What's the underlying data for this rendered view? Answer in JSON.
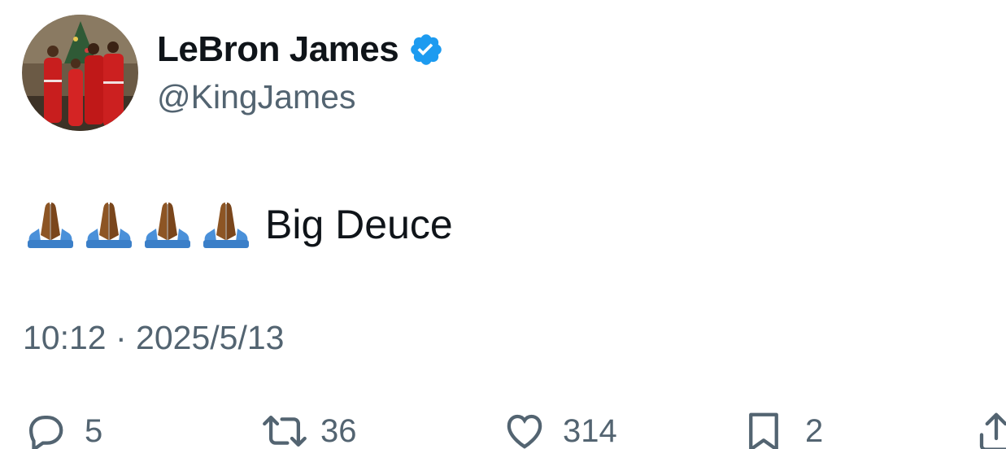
{
  "author": {
    "display_name": "LeBron James",
    "handle": "@KingJames",
    "verified": true,
    "avatar_icon": "family-photo-avatar"
  },
  "tweet": {
    "emoji": [
      "🙏🏾",
      "🙏🏾",
      "🙏🏾",
      "🙏🏾"
    ],
    "text": "Big Deuce",
    "timestamp": "10:12 · 2025/5/13"
  },
  "actions": {
    "replies": {
      "icon": "reply-icon",
      "count": "5"
    },
    "reposts": {
      "icon": "repost-icon",
      "count": "36"
    },
    "likes": {
      "icon": "like-icon",
      "count": "314"
    },
    "bookmarks": {
      "icon": "bookmark-icon",
      "count": "2"
    },
    "share": {
      "icon": "share-icon"
    }
  },
  "colors": {
    "text_primary": "#0f1419",
    "text_secondary": "#536471",
    "verified_blue": "#1d9bf0",
    "skin": "#8d5524",
    "sleeve": "#4a90d9"
  }
}
